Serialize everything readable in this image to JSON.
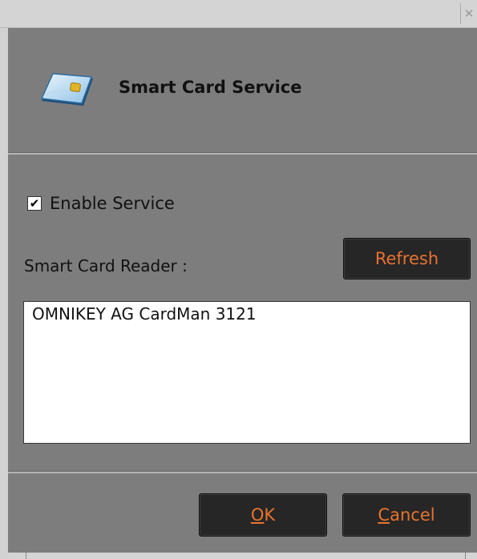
{
  "window": {
    "close_glyph": "✕"
  },
  "header": {
    "title": "Smart Card Service",
    "icon": "smart-card-icon"
  },
  "service": {
    "enable_label": "Enable Service",
    "enabled": true,
    "check_glyph": "✔"
  },
  "reader": {
    "label": "Smart Card Reader :",
    "refresh_label": "Refresh",
    "items": [
      "OMNIKEY AG CardMan 3121"
    ]
  },
  "footer": {
    "ok_mnemonic": "O",
    "ok_rest": "K",
    "cancel_mnemonic": "C",
    "cancel_rest": "ancel"
  },
  "colors": {
    "dialog_bg": "#7d7d7d",
    "button_bg": "#262626",
    "button_text": "#e8732f"
  }
}
